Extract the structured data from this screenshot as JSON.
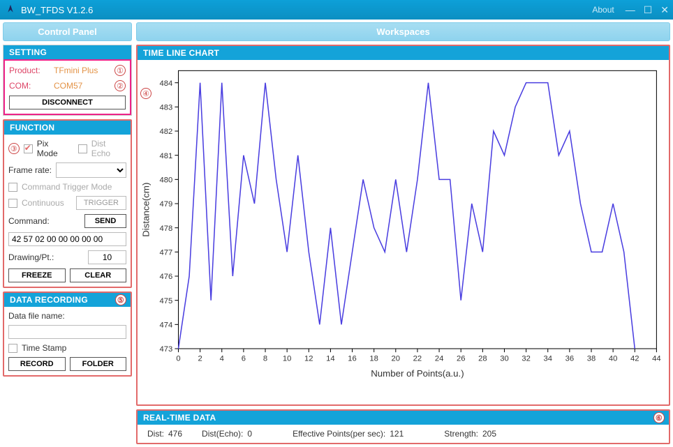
{
  "window": {
    "title": "BW_TFDS V1.2.6",
    "about": "About"
  },
  "left_header": "Control Panel",
  "right_header": "Workspaces",
  "setting": {
    "title": "SETTING",
    "product_label": "Product:",
    "product_value": "TFmini Plus",
    "com_label": "COM:",
    "com_value": "COM57",
    "disconnect": "DISCONNECT",
    "badge1": "①",
    "badge2": "②"
  },
  "function": {
    "title": "FUNCTION",
    "pix_mode": "Pix Mode",
    "dist_echo": "Dist Echo",
    "frame_rate_label": "Frame rate:",
    "frame_rate_value": "",
    "cmd_trigger": "Command Trigger Mode",
    "continuous": "Continuous",
    "trigger": "TRIGGER",
    "command_label": "Command:",
    "send": "SEND",
    "command_value": "42 57 02 00 00 00 00 00",
    "drawing_label": "Drawing/Pt.:",
    "drawing_value": "10",
    "freeze": "FREEZE",
    "clear": "CLEAR",
    "badge3": "③"
  },
  "recording": {
    "title": "DATA RECORDING",
    "file_label": "Data file name:",
    "file_value": "",
    "time_stamp": "Time Stamp",
    "record": "RECORD",
    "folder": "FOLDER",
    "badge5": "⑤"
  },
  "chart": {
    "title": "TIME LINE CHART",
    "badge4": "④",
    "ylabel": "Distance(cm)",
    "xlabel": "Number of Points(a.u.)"
  },
  "chart_data": {
    "type": "line",
    "x": [
      0,
      1,
      2,
      3,
      4,
      5,
      6,
      7,
      8,
      9,
      10,
      11,
      12,
      13,
      14,
      15,
      16,
      17,
      18,
      19,
      20,
      21,
      22,
      23,
      24,
      25,
      26,
      27,
      28,
      29,
      30,
      31,
      32,
      33,
      34,
      35,
      36,
      37,
      38,
      39,
      40,
      41,
      42
    ],
    "values": [
      473,
      476,
      484,
      475,
      484,
      476,
      481,
      479,
      484,
      480,
      477,
      481,
      477,
      474,
      478,
      474,
      477,
      480,
      478,
      477,
      480,
      477,
      480,
      484,
      480,
      480,
      475,
      479,
      477,
      482,
      481,
      483,
      484,
      484,
      484,
      481,
      482,
      479,
      477,
      477,
      479,
      477,
      473
    ],
    "x_ticks": [
      0,
      2,
      4,
      6,
      8,
      10,
      12,
      14,
      16,
      18,
      20,
      22,
      24,
      26,
      28,
      30,
      32,
      34,
      36,
      38,
      40,
      42,
      44
    ],
    "y_ticks": [
      473,
      474,
      475,
      476,
      477,
      478,
      479,
      480,
      481,
      482,
      483,
      484
    ],
    "xlim": [
      0,
      44
    ],
    "ylim": [
      473,
      484.5
    ],
    "xlabel": "Number of Points(a.u.)",
    "ylabel": "Distance(cm)",
    "title": ""
  },
  "realtime": {
    "title": "REAL-TIME DATA",
    "badge6": "⑥",
    "dist_k": "Dist:",
    "dist_v": "476",
    "echo_k": "Dist(Echo):",
    "echo_v": "0",
    "eff_k": "Effective Points(per sec):",
    "eff_v": "121",
    "str_k": "Strength:",
    "str_v": "205"
  }
}
